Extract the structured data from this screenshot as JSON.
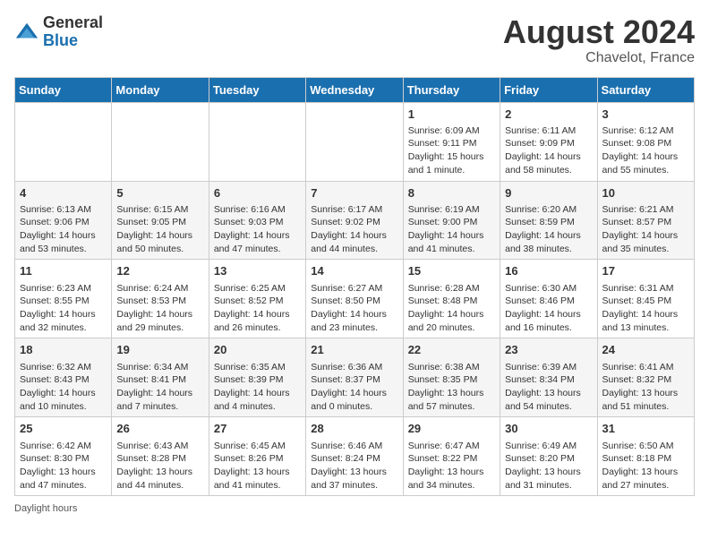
{
  "header": {
    "logo_general": "General",
    "logo_blue": "Blue",
    "month_title": "August 2024",
    "location": "Chavelot, France"
  },
  "footer": {
    "daylight_label": "Daylight hours"
  },
  "days_of_week": [
    "Sunday",
    "Monday",
    "Tuesday",
    "Wednesday",
    "Thursday",
    "Friday",
    "Saturday"
  ],
  "weeks": [
    [
      {
        "day": "",
        "info": ""
      },
      {
        "day": "",
        "info": ""
      },
      {
        "day": "",
        "info": ""
      },
      {
        "day": "",
        "info": ""
      },
      {
        "day": "1",
        "info": "Sunrise: 6:09 AM\nSunset: 9:11 PM\nDaylight: 15 hours and 1 minute."
      },
      {
        "day": "2",
        "info": "Sunrise: 6:11 AM\nSunset: 9:09 PM\nDaylight: 14 hours and 58 minutes."
      },
      {
        "day": "3",
        "info": "Sunrise: 6:12 AM\nSunset: 9:08 PM\nDaylight: 14 hours and 55 minutes."
      }
    ],
    [
      {
        "day": "4",
        "info": "Sunrise: 6:13 AM\nSunset: 9:06 PM\nDaylight: 14 hours and 53 minutes."
      },
      {
        "day": "5",
        "info": "Sunrise: 6:15 AM\nSunset: 9:05 PM\nDaylight: 14 hours and 50 minutes."
      },
      {
        "day": "6",
        "info": "Sunrise: 6:16 AM\nSunset: 9:03 PM\nDaylight: 14 hours and 47 minutes."
      },
      {
        "day": "7",
        "info": "Sunrise: 6:17 AM\nSunset: 9:02 PM\nDaylight: 14 hours and 44 minutes."
      },
      {
        "day": "8",
        "info": "Sunrise: 6:19 AM\nSunset: 9:00 PM\nDaylight: 14 hours and 41 minutes."
      },
      {
        "day": "9",
        "info": "Sunrise: 6:20 AM\nSunset: 8:59 PM\nDaylight: 14 hours and 38 minutes."
      },
      {
        "day": "10",
        "info": "Sunrise: 6:21 AM\nSunset: 8:57 PM\nDaylight: 14 hours and 35 minutes."
      }
    ],
    [
      {
        "day": "11",
        "info": "Sunrise: 6:23 AM\nSunset: 8:55 PM\nDaylight: 14 hours and 32 minutes."
      },
      {
        "day": "12",
        "info": "Sunrise: 6:24 AM\nSunset: 8:53 PM\nDaylight: 14 hours and 29 minutes."
      },
      {
        "day": "13",
        "info": "Sunrise: 6:25 AM\nSunset: 8:52 PM\nDaylight: 14 hours and 26 minutes."
      },
      {
        "day": "14",
        "info": "Sunrise: 6:27 AM\nSunset: 8:50 PM\nDaylight: 14 hours and 23 minutes."
      },
      {
        "day": "15",
        "info": "Sunrise: 6:28 AM\nSunset: 8:48 PM\nDaylight: 14 hours and 20 minutes."
      },
      {
        "day": "16",
        "info": "Sunrise: 6:30 AM\nSunset: 8:46 PM\nDaylight: 14 hours and 16 minutes."
      },
      {
        "day": "17",
        "info": "Sunrise: 6:31 AM\nSunset: 8:45 PM\nDaylight: 14 hours and 13 minutes."
      }
    ],
    [
      {
        "day": "18",
        "info": "Sunrise: 6:32 AM\nSunset: 8:43 PM\nDaylight: 14 hours and 10 minutes."
      },
      {
        "day": "19",
        "info": "Sunrise: 6:34 AM\nSunset: 8:41 PM\nDaylight: 14 hours and 7 minutes."
      },
      {
        "day": "20",
        "info": "Sunrise: 6:35 AM\nSunset: 8:39 PM\nDaylight: 14 hours and 4 minutes."
      },
      {
        "day": "21",
        "info": "Sunrise: 6:36 AM\nSunset: 8:37 PM\nDaylight: 14 hours and 0 minutes."
      },
      {
        "day": "22",
        "info": "Sunrise: 6:38 AM\nSunset: 8:35 PM\nDaylight: 13 hours and 57 minutes."
      },
      {
        "day": "23",
        "info": "Sunrise: 6:39 AM\nSunset: 8:34 PM\nDaylight: 13 hours and 54 minutes."
      },
      {
        "day": "24",
        "info": "Sunrise: 6:41 AM\nSunset: 8:32 PM\nDaylight: 13 hours and 51 minutes."
      }
    ],
    [
      {
        "day": "25",
        "info": "Sunrise: 6:42 AM\nSunset: 8:30 PM\nDaylight: 13 hours and 47 minutes."
      },
      {
        "day": "26",
        "info": "Sunrise: 6:43 AM\nSunset: 8:28 PM\nDaylight: 13 hours and 44 minutes."
      },
      {
        "day": "27",
        "info": "Sunrise: 6:45 AM\nSunset: 8:26 PM\nDaylight: 13 hours and 41 minutes."
      },
      {
        "day": "28",
        "info": "Sunrise: 6:46 AM\nSunset: 8:24 PM\nDaylight: 13 hours and 37 minutes."
      },
      {
        "day": "29",
        "info": "Sunrise: 6:47 AM\nSunset: 8:22 PM\nDaylight: 13 hours and 34 minutes."
      },
      {
        "day": "30",
        "info": "Sunrise: 6:49 AM\nSunset: 8:20 PM\nDaylight: 13 hours and 31 minutes."
      },
      {
        "day": "31",
        "info": "Sunrise: 6:50 AM\nSunset: 8:18 PM\nDaylight: 13 hours and 27 minutes."
      }
    ]
  ]
}
